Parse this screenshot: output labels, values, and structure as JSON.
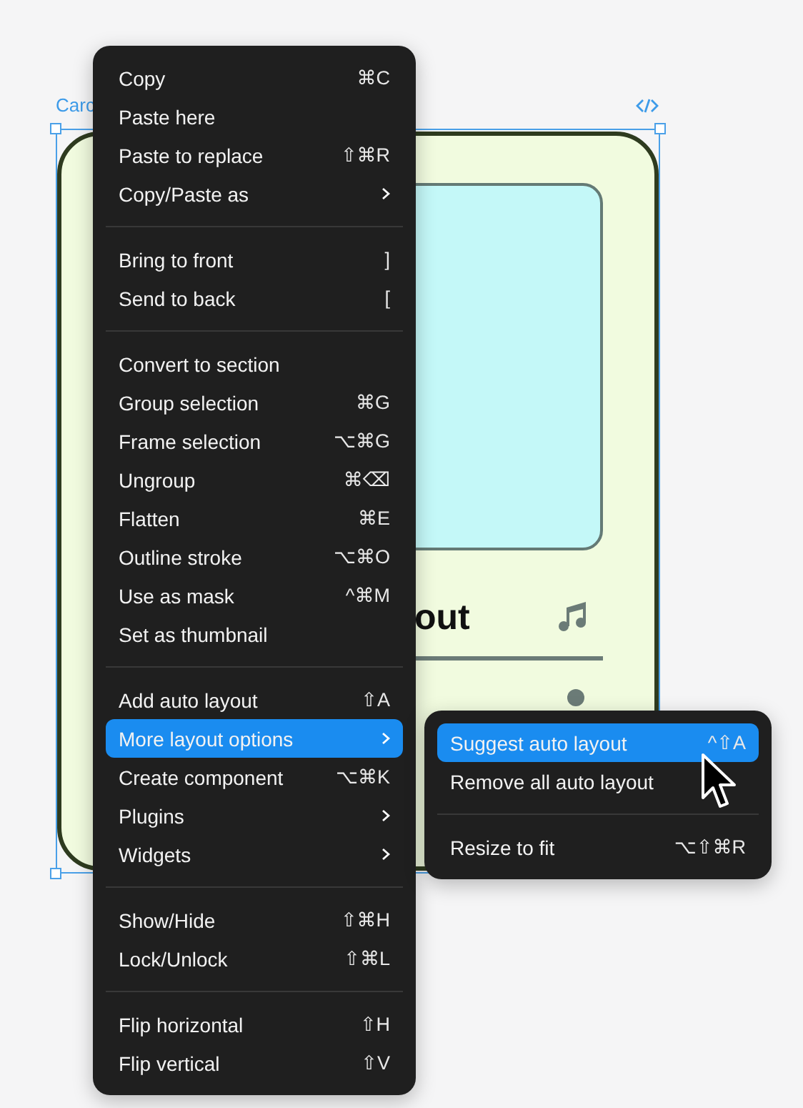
{
  "canvas": {
    "frame_label": "Carc",
    "card": {
      "title": "out"
    }
  },
  "context_menu": {
    "sections": [
      [
        {
          "label": "Copy",
          "shortcut": "⌘C",
          "submenu": false,
          "selected": false
        },
        {
          "label": "Paste here",
          "submenu": false,
          "selected": false
        },
        {
          "label": "Paste to replace",
          "shortcut": "⇧⌘R",
          "submenu": false,
          "selected": false
        },
        {
          "label": "Copy/Paste as",
          "submenu": true,
          "selected": false
        }
      ],
      [
        {
          "label": "Bring to front",
          "shortcut": "]",
          "submenu": false,
          "selected": false
        },
        {
          "label": "Send to back",
          "shortcut": "[",
          "submenu": false,
          "selected": false
        }
      ],
      [
        {
          "label": "Convert to section",
          "submenu": false,
          "selected": false
        },
        {
          "label": "Group selection",
          "shortcut": "⌘G",
          "submenu": false,
          "selected": false
        },
        {
          "label": "Frame selection",
          "shortcut": "⌥⌘G",
          "submenu": false,
          "selected": false
        },
        {
          "label": "Ungroup",
          "shortcut": "⌘⌫",
          "submenu": false,
          "selected": false
        },
        {
          "label": "Flatten",
          "shortcut": "⌘E",
          "submenu": false,
          "selected": false
        },
        {
          "label": "Outline stroke",
          "shortcut": "⌥⌘O",
          "submenu": false,
          "selected": false
        },
        {
          "label": "Use as mask",
          "shortcut": "^⌘M",
          "submenu": false,
          "selected": false
        },
        {
          "label": "Set as thumbnail",
          "submenu": false,
          "selected": false
        }
      ],
      [
        {
          "label": "Add auto layout",
          "shortcut": "⇧A",
          "submenu": false,
          "selected": false
        },
        {
          "label": "More layout options",
          "submenu": true,
          "selected": true
        },
        {
          "label": "Create component",
          "shortcut": "⌥⌘K",
          "submenu": false,
          "selected": false
        },
        {
          "label": "Plugins",
          "submenu": true,
          "selected": false
        },
        {
          "label": "Widgets",
          "submenu": true,
          "selected": false
        }
      ],
      [
        {
          "label": "Show/Hide",
          "shortcut": "⇧⌘H",
          "submenu": false,
          "selected": false
        },
        {
          "label": "Lock/Unlock",
          "shortcut": "⇧⌘L",
          "submenu": false,
          "selected": false
        }
      ],
      [
        {
          "label": "Flip horizontal",
          "shortcut": "⇧H",
          "submenu": false,
          "selected": false
        },
        {
          "label": "Flip vertical",
          "shortcut": "⇧V",
          "submenu": false,
          "selected": false
        }
      ]
    ]
  },
  "submenu": {
    "sections": [
      [
        {
          "label": "Suggest auto layout",
          "shortcut": "^⇧A",
          "submenu": false,
          "selected": true
        },
        {
          "label": "Remove all auto layout",
          "submenu": false,
          "selected": false
        }
      ],
      [
        {
          "label": "Resize to fit",
          "shortcut": "⌥⇧⌘R",
          "submenu": false,
          "selected": false
        }
      ]
    ]
  }
}
